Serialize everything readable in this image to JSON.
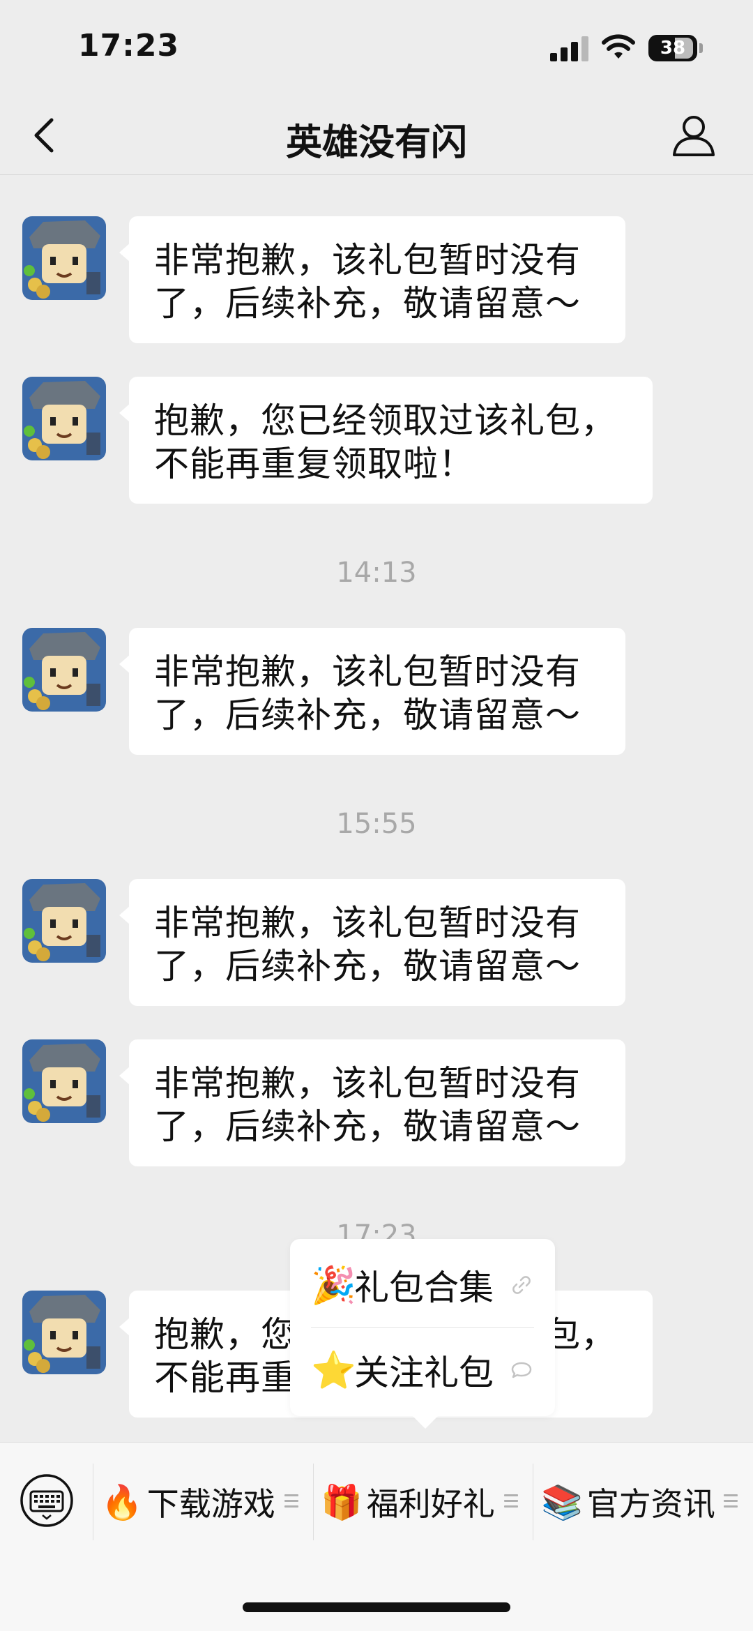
{
  "status_bar": {
    "time": "17:23",
    "battery": "38"
  },
  "nav": {
    "title": "英雄没有闪"
  },
  "messages": [
    {
      "line1": "非常抱歉，该礼包暂时没有",
      "line2": "了，后续补充，敬请留意～"
    },
    {
      "line1": "抱歉，您已经领取过该礼包，",
      "line2": "不能再重复领取啦！"
    },
    {
      "line1": "非常抱歉，该礼包暂时没有",
      "line2": "了，后续补充，敬请留意～"
    },
    {
      "line1": "非常抱歉，该礼包暂时没有",
      "line2": "了，后续补充，敬请留意～"
    },
    {
      "line1": "非常抱歉，该礼包暂时没有",
      "line2": "了，后续补充，敬请留意～"
    },
    {
      "line1": "抱歉，您已经领取过该礼包，",
      "line2": "不能再重复领取啦！"
    }
  ],
  "timestamps": [
    "14:13",
    "15:55",
    "17:23"
  ],
  "popup_menu": {
    "items": [
      {
        "emoji": "🎉",
        "label": "礼包合集",
        "icon": "link-icon"
      },
      {
        "emoji": "⭐",
        "label": "关注礼包",
        "icon": "chat-bubble-icon"
      }
    ]
  },
  "bottom_menu": {
    "items": [
      {
        "emoji": "🔥",
        "label": "下载游戏"
      },
      {
        "emoji": "🎁",
        "label": "福利好礼"
      },
      {
        "emoji": "📚",
        "label": "官方资讯"
      }
    ]
  }
}
